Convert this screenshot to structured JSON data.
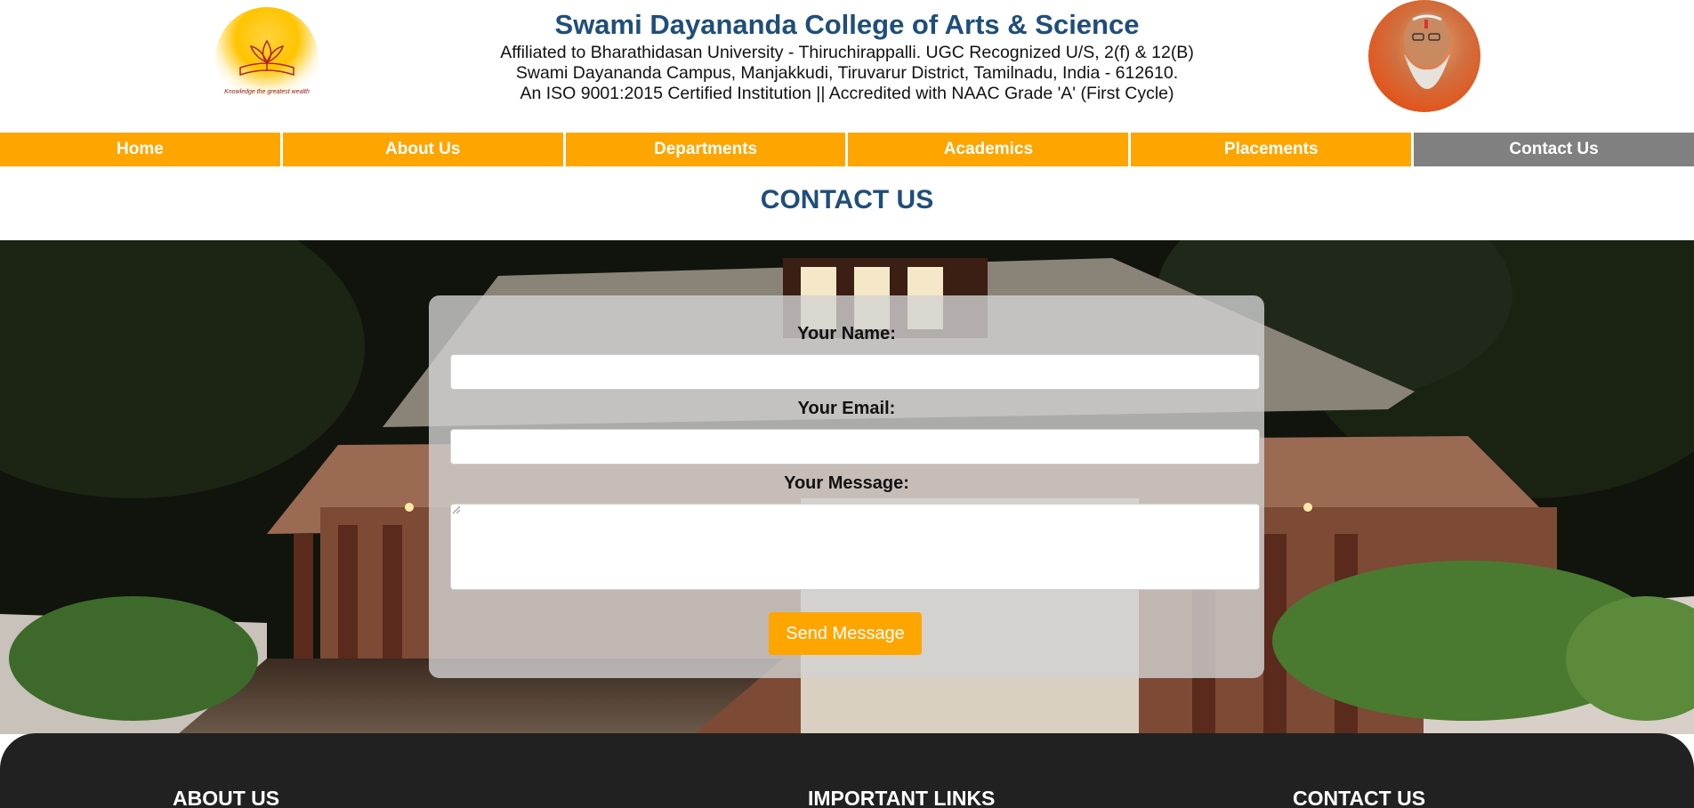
{
  "header": {
    "college_name": "Swami Dayananda College of Arts & Science",
    "lines": [
      "Affiliated to Bharathidasan University - Thiruchirappalli. UGC Recognized U/S, 2(f) & 12(B)",
      "Swami Dayananda Campus, Manjakkudi, Tiruvarur District, Tamilnadu, India - 612610.",
      "An ISO 9001:2015 Certified Institution || Accredited with NAAC Grade 'A' (First Cycle)"
    ],
    "logo_tagline": "Knowledge the greatest wealth"
  },
  "nav": {
    "items": [
      "Home",
      "About Us",
      "Departments",
      "Academics",
      "Placements",
      "Contact Us"
    ],
    "active": "Contact Us"
  },
  "page_heading": "CONTACT US",
  "form": {
    "name_label": "Your Name:",
    "email_label": "Your Email:",
    "message_label": "Your Message:",
    "name_value": "",
    "email_value": "",
    "message_value": "",
    "send_label": "Send Message"
  },
  "footer": {
    "about_heading": "ABOUT US",
    "links_heading": "IMPORTANT LINKS",
    "contact_heading": "CONTACT US"
  },
  "colors": {
    "accent": "#ffa500",
    "nav_active": "#808080",
    "heading": "#1f4e79",
    "footer_bg": "#212121"
  }
}
